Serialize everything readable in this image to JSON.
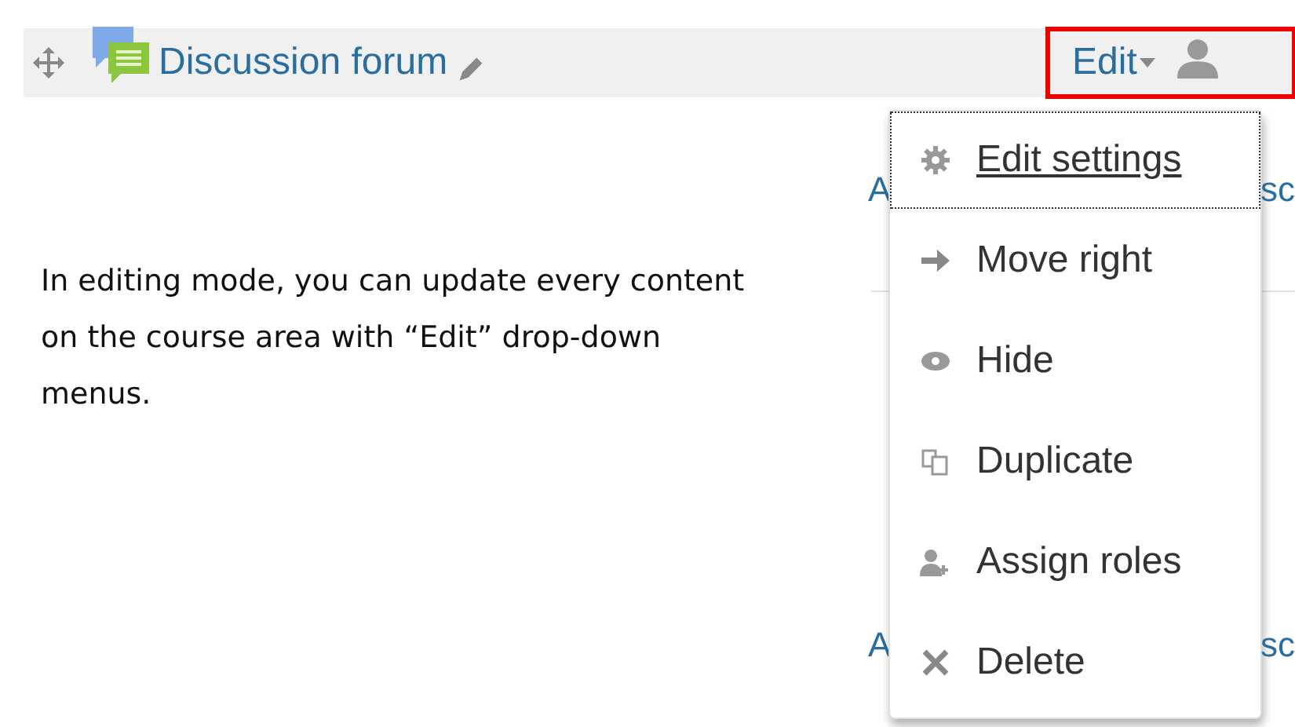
{
  "activity": {
    "title": "Discussion forum",
    "edit_label": "Edit",
    "highlighted": true
  },
  "background_rows": [
    {
      "left": "A",
      "right": "sc"
    },
    {
      "left": "A",
      "right": "sc"
    }
  ],
  "note": "In editing mode, you can update every content on the course area with “Edit” drop-down menus.",
  "menu": [
    {
      "kind": "gear",
      "label": "Edit settings",
      "selected": true
    },
    {
      "kind": "arrow",
      "label": "Move right",
      "selected": false
    },
    {
      "kind": "eye",
      "label": "Hide",
      "selected": false
    },
    {
      "kind": "copy",
      "label": "Duplicate",
      "selected": false
    },
    {
      "kind": "user-plus",
      "label": "Assign roles",
      "selected": false
    },
    {
      "kind": "cross",
      "label": "Delete",
      "selected": false
    }
  ]
}
